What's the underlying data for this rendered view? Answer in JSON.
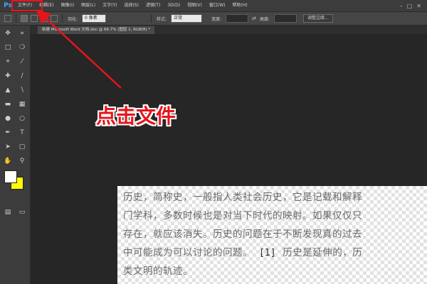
{
  "app": {
    "logo": "Ps"
  },
  "menu": {
    "items": [
      "文件(F)",
      "编辑(E)",
      "图像(I)",
      "图层(L)",
      "文字(Y)",
      "选择(S)",
      "滤镜(T)",
      "3D(D)",
      "视图(V)",
      "窗口(W)",
      "帮助(H)"
    ]
  },
  "options": {
    "feather_label": "羽化:",
    "feather_value": "0 像素",
    "style_label": "样式:",
    "style_value": "正常",
    "width_label": "宽度:",
    "height_label": "高度:",
    "refine_edge_label": "调整边缘..."
  },
  "document_tab": {
    "title": "新建 Microsoft Word 文档.doc @ 66.7% (图层 1, RGB/8) *"
  },
  "document_text": {
    "line1": "历史，简称史，一般指人类社会历史，它是记载和解释",
    "line2": "门学科，多数时候也是对当下时代的映射。如果仅仅只",
    "line3": "存在，就应该消失。历史的问题在于不断发现真的过去",
    "line4a": "中可能成为可以讨论的问题。",
    "line4_cite": "[1]",
    "line4b": "历史是延伸的，历",
    "line5": "类文明的轨迹。"
  },
  "annotation": {
    "text": "点击文件",
    "color": "#e8141c"
  },
  "colors": {
    "foreground": "#ffffff",
    "background": "#ffff00"
  }
}
